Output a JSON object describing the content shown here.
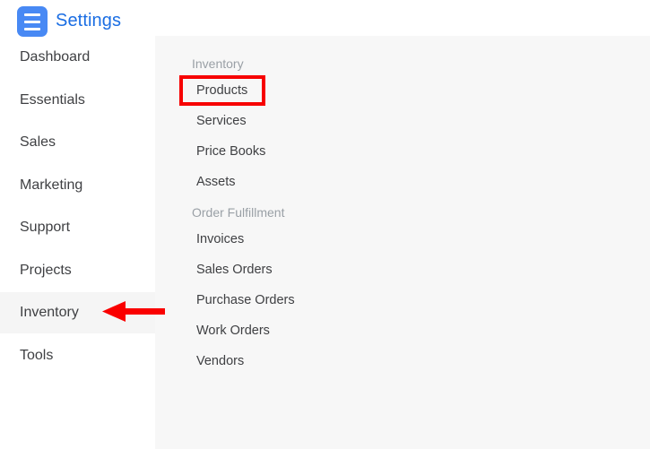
{
  "header": {
    "title": "Settings",
    "menu_icon": "hamburger-menu-icon",
    "accent_color": "#1b6ee3",
    "menu_button_color": "#4889f4"
  },
  "sidebar": {
    "items": [
      {
        "label": "Dashboard",
        "active": false
      },
      {
        "label": "Essentials",
        "active": false
      },
      {
        "label": "Sales",
        "active": false
      },
      {
        "label": "Marketing",
        "active": false
      },
      {
        "label": "Support",
        "active": false
      },
      {
        "label": "Projects",
        "active": false
      },
      {
        "label": "Inventory",
        "active": true
      },
      {
        "label": "Tools",
        "active": false
      }
    ],
    "active_highlight_color": "#f5f5f5"
  },
  "panel": {
    "background_color": "#f7f7f7",
    "sections": [
      {
        "title": "Inventory",
        "items": [
          {
            "label": "Products",
            "highlighted": true
          },
          {
            "label": "Services",
            "highlighted": false
          },
          {
            "label": "Price Books",
            "highlighted": false
          },
          {
            "label": "Assets",
            "highlighted": false
          }
        ]
      },
      {
        "title": "Order Fulfillment",
        "items": [
          {
            "label": "Invoices",
            "highlighted": false
          },
          {
            "label": "Sales Orders",
            "highlighted": false
          },
          {
            "label": "Purchase Orders",
            "highlighted": false
          },
          {
            "label": "Work Orders",
            "highlighted": false
          },
          {
            "label": "Vendors",
            "highlighted": false
          }
        ]
      }
    ]
  },
  "annotations": {
    "highlight_box": {
      "target": "Products",
      "color": "#f70000"
    },
    "pointer_arrow": {
      "target": "Inventory",
      "color": "#fa0000",
      "direction": "left"
    }
  }
}
